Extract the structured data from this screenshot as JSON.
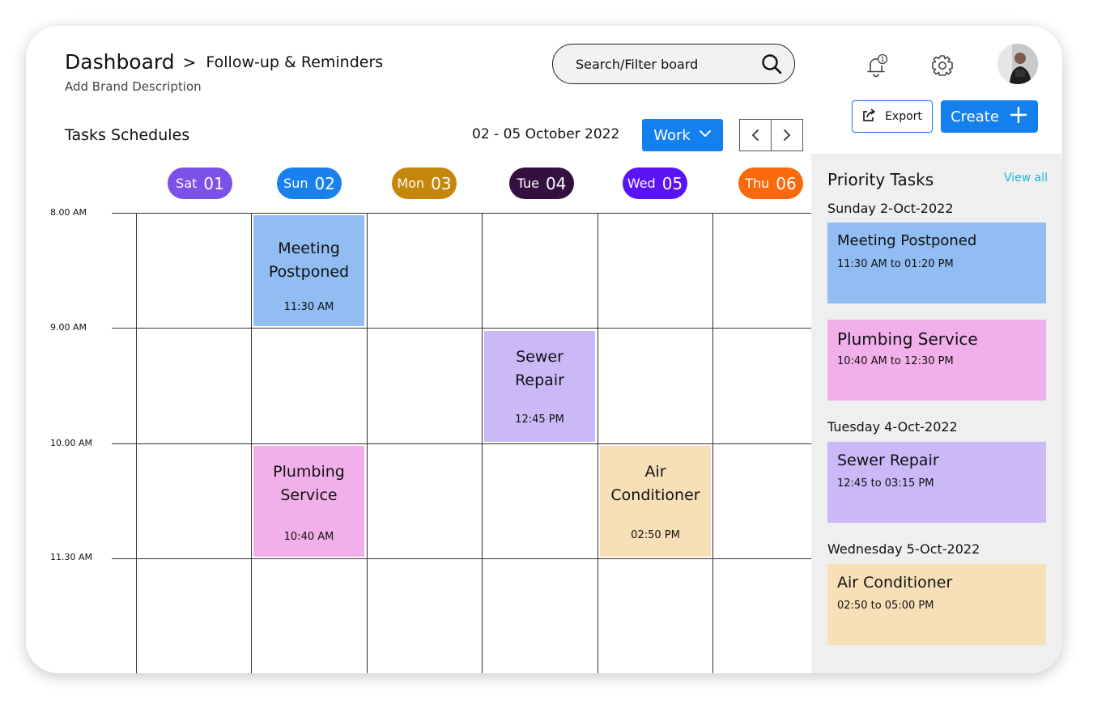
{
  "header": {
    "title": "Dashboard",
    "breadcrumb_sep": ">",
    "subtitle": "Follow-up & Reminders",
    "brand_description": "Add Brand Description"
  },
  "search": {
    "placeholder": "Search/Filter board",
    "icon": "search-icon"
  },
  "top_icons": {
    "notifications": "bell-icon",
    "notification_count": "1",
    "settings": "gear-icon",
    "profile": "avatar"
  },
  "actions": {
    "export_label": "Export",
    "create_label": "Create"
  },
  "schedule": {
    "title": "Tasks Schedules",
    "date_range": "02 - 05 October 2022",
    "filter_value": "Work",
    "days": [
      {
        "name": "Sat",
        "date": "01",
        "color": "#7b52e8"
      },
      {
        "name": "Sun",
        "date": "02",
        "color": "#1a80ee"
      },
      {
        "name": "Mon",
        "date": "03",
        "color": "#c4860b"
      },
      {
        "name": "Tue",
        "date": "04",
        "color": "#341040"
      },
      {
        "name": "Wed",
        "date": "05",
        "color": "#5a13f5"
      },
      {
        "name": "Thu",
        "date": "06",
        "color": "#f86a0c"
      }
    ],
    "time_slots": [
      "8.00 AM",
      "9.00 AM",
      "10.00 AM",
      "11.30 AM"
    ],
    "events": [
      {
        "name": "Meeting Postponed",
        "time": "11:30 AM",
        "day": 1,
        "slot": 0,
        "color": "#91bdf3"
      },
      {
        "name": "Sewer Repair",
        "time": "12:45 PM",
        "day": 3,
        "slot": 1,
        "color": "#cbb8f7"
      },
      {
        "name": "Plumbing Service",
        "time": "10:40 AM",
        "day": 1,
        "slot": 2,
        "color": "#f2b0ea"
      },
      {
        "name": "Air Conditioner",
        "time": "02:50 PM",
        "day": 4,
        "slot": 2,
        "color": "#f7e0b7"
      }
    ]
  },
  "priority": {
    "title": "Priority Tasks",
    "view_all": "View all",
    "groups": [
      {
        "date": "Sunday 2-Oct-2022",
        "tasks": [
          {
            "name": "Meeting Postponed",
            "time": "11:30 AM to 01:20 PM",
            "color": "#91bdf3"
          },
          {
            "name": "Plumbing Service",
            "time": "10:40 AM to 12:30 PM",
            "color": "#f2b0ea"
          }
        ]
      },
      {
        "date": "Tuesday 4-Oct-2022",
        "tasks": [
          {
            "name": "Sewer Repair",
            "time": "12:45 to 03:15 PM",
            "color": "#cbb8f7"
          }
        ]
      },
      {
        "date": "Wednesday 5-Oct-2022",
        "tasks": [
          {
            "name": "Air Conditioner",
            "time": "02:50 to 05:00 PM",
            "color": "#f7e0b7"
          }
        ]
      }
    ]
  }
}
